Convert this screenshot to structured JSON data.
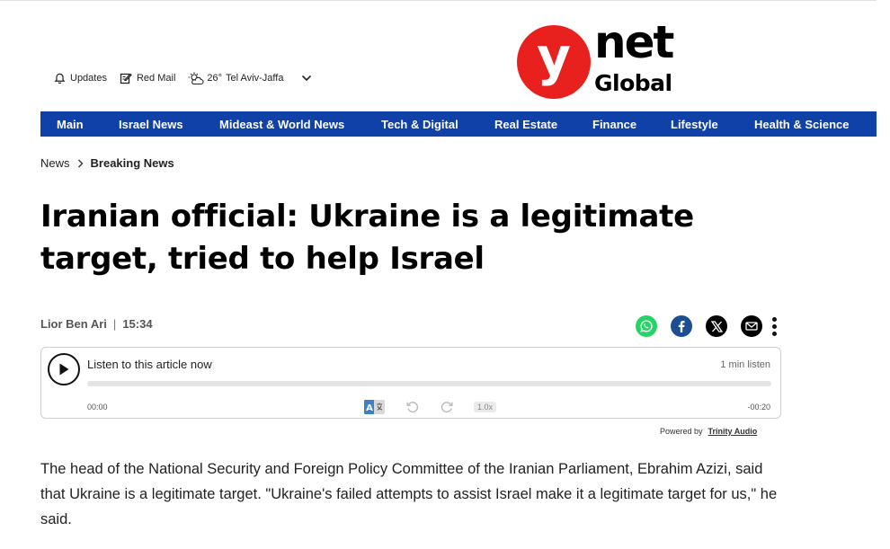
{
  "header": {
    "updates_label": "Updates",
    "redmail_label": "Red Mail",
    "weather_temp": "26°",
    "weather_city": "Tel Aviv-Jaffa",
    "icons": [
      "bell-icon",
      "edit-icon",
      "partly-cloudy-icon",
      "chevron-down-icon"
    ]
  },
  "logo": {
    "y": "y",
    "net": "net",
    "global": "Global",
    "brand_color": "#e8211e"
  },
  "nav": {
    "bg_color": "#0f41a8",
    "items": [
      {
        "label": "Main"
      },
      {
        "label": "Israel News"
      },
      {
        "label": "Mideast & World News"
      },
      {
        "label": "Tech & Digital"
      },
      {
        "label": "Real Estate"
      },
      {
        "label": "Finance"
      },
      {
        "label": "Lifestyle"
      },
      {
        "label": "Health & Science"
      }
    ]
  },
  "breadcrumb": {
    "parent": "News",
    "current": "Breaking News"
  },
  "article": {
    "headline": "Iranian official: Ukraine is a legitimate target, tried to help Israel",
    "author": "Lior Ben Ari",
    "separator": "|",
    "time": "15:34",
    "body": "The head of the National Security and Foreign Policy Committee of the Iranian Parliament, Ebrahim Azizi, said that Ukraine is a legitimate target. \"Ukraine's failed attempts to assist Israel make it a legitimate target for us,\" he said."
  },
  "share": {
    "icons": [
      "whatsapp-icon",
      "facebook-icon",
      "x-icon",
      "email-icon",
      "more-icon"
    ],
    "colors": {
      "whatsapp": "#25d366",
      "facebook": "#1d4e93",
      "x": "#000000",
      "email": "#000000"
    }
  },
  "player": {
    "title": "Listen to this article now",
    "duration": "1 min listen",
    "time_start": "00:00",
    "time_end": "-00:20",
    "speed": "1.0x",
    "progress": 0,
    "powered_by_label": "Powered by",
    "powered_by_brand": "Trinity Audio"
  }
}
